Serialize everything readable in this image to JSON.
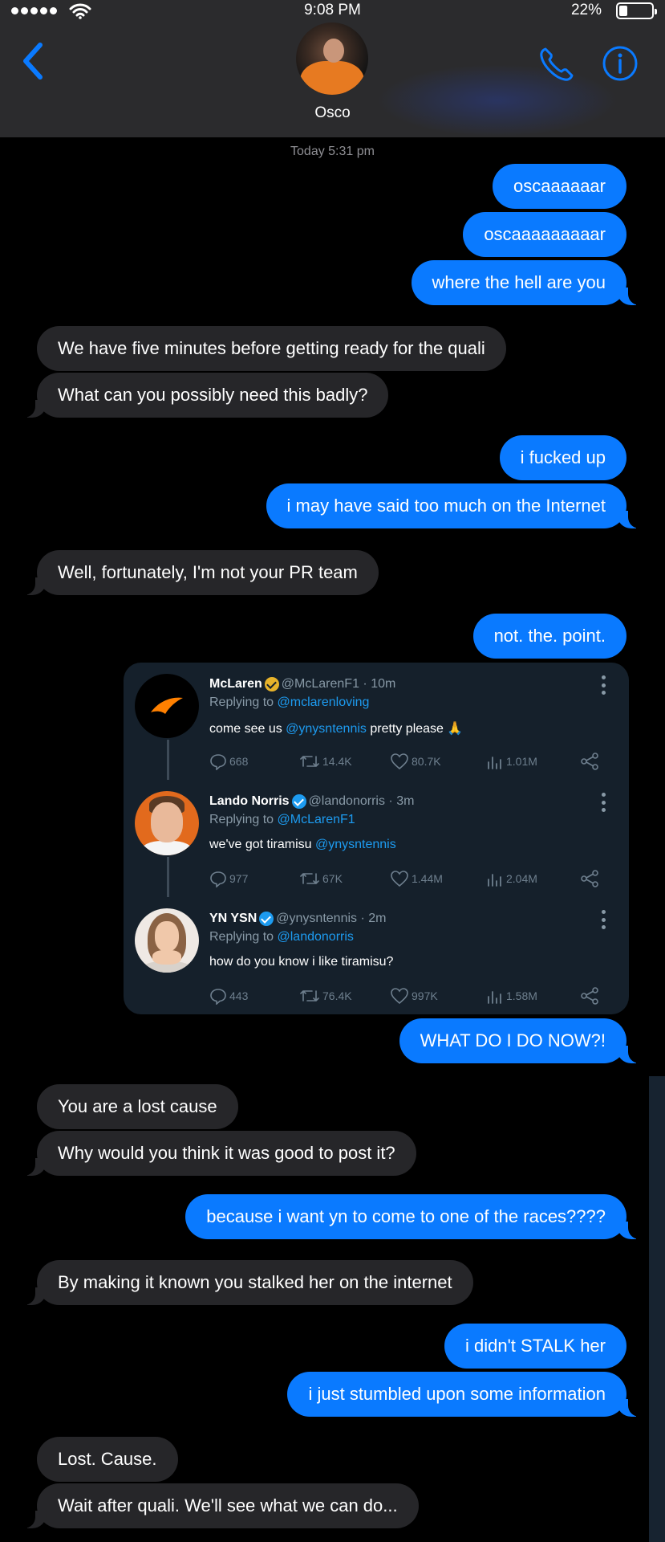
{
  "status_bar": {
    "time": "9:08 PM",
    "battery_percent": "22%",
    "battery_level": 0.22,
    "signal_bars": 5
  },
  "header": {
    "contact_name": "Osco"
  },
  "conversation": {
    "timestamp": "Today 5:31 pm",
    "messages": [
      {
        "from": "me",
        "text": "oscaaaaaar"
      },
      {
        "from": "me",
        "text": "oscaaaaaaaaar"
      },
      {
        "from": "me",
        "text": "where the hell are you"
      },
      {
        "from": "them",
        "text": "We have five minutes before getting ready for the quali"
      },
      {
        "from": "them",
        "text": "What can you possibly need this badly?"
      },
      {
        "from": "me",
        "text": "i fucked up"
      },
      {
        "from": "me",
        "text": "i may have said too much on the Internet"
      },
      {
        "from": "them",
        "text": "Well, fortunately, I'm not your PR team"
      },
      {
        "from": "me",
        "text": "not. the. point."
      },
      {
        "from": "me",
        "text": "WHAT DO I DO NOW?!"
      },
      {
        "from": "them",
        "text": "You are a lost cause"
      },
      {
        "from": "them",
        "text": "Why would you think it was good to post it?"
      },
      {
        "from": "me",
        "text": "because i want yn to come to one of the races????"
      },
      {
        "from": "them",
        "text": "By making it known you stalked her on the internet"
      },
      {
        "from": "me",
        "text": "i didn't STALK her"
      },
      {
        "from": "me",
        "text": "i just stumbled upon some information"
      },
      {
        "from": "them",
        "text": "Lost. Cause."
      },
      {
        "from": "them",
        "text": "Wait after quali. We'll see what we can do..."
      }
    ]
  },
  "tweets": [
    {
      "name": "McLaren",
      "handle": "@McLarenF1",
      "time": "· 10m",
      "replying_prefix": "Replying to ",
      "replying_to": "@mclarenloving",
      "text_before": "come see us ",
      "mention": "@ynysntennis",
      "text_after": " pretty please 🙏",
      "replies": "668",
      "retweets": "14.4K",
      "likes": "80.7K",
      "views": "1.01M"
    },
    {
      "name": "Lando Norris",
      "handle": "@landonorris",
      "time": "· 3m",
      "replying_prefix": "Replying to ",
      "replying_to": "@McLarenF1",
      "text_before": "we've got tiramisu ",
      "mention": "@ynysntennis",
      "text_after": "",
      "replies": "977",
      "retweets": "67K",
      "likes": "1.44M",
      "views": "2.04M"
    },
    {
      "name": "YN YSN",
      "handle": "@ynysntennis",
      "time": "· 2m",
      "replying_prefix": "Replying to ",
      "replying_to": "@landonorris",
      "text_before": "how do you know i like tiramisu?",
      "mention": "",
      "text_after": "",
      "replies": "443",
      "retweets": "76.4K",
      "likes": "997K",
      "views": "1.58M"
    }
  ],
  "colors": {
    "sent_bubble": "#0a7aff",
    "received_bubble": "#262629",
    "header_bg": "#2b2b2d",
    "tweet_card_bg": "#15202b",
    "accent_blue": "#1d9bf0",
    "mclaren_orange": "#e77a21"
  },
  "icons": {
    "back": "chevron-left-icon",
    "call": "phone-icon",
    "info": "info-icon",
    "reply": "comment-icon",
    "retweet": "retweet-icon",
    "like": "heart-icon",
    "views": "views-chart-icon",
    "share": "share-icon",
    "more": "more-vertical-icon",
    "verified_org": "verified-gold-badge-icon",
    "verified": "verified-blue-badge-icon"
  }
}
